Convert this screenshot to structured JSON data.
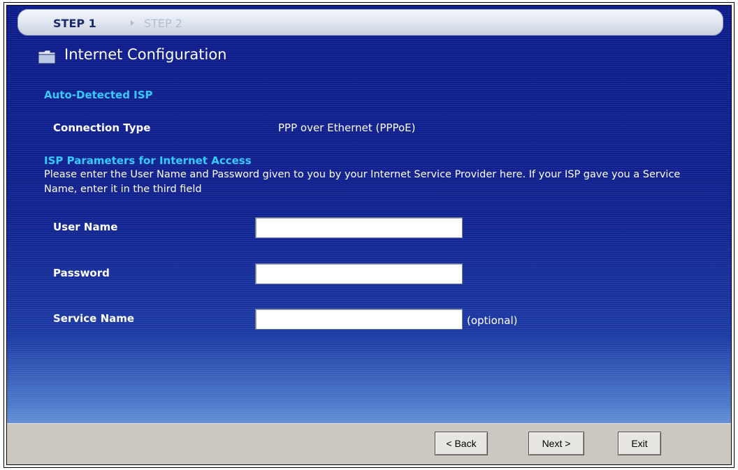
{
  "steps": {
    "current": "STEP 1",
    "next": "STEP 2"
  },
  "page": {
    "title": "Internet Configuration"
  },
  "auto_detect": {
    "heading": "Auto-Detected ISP",
    "connection_type_label": "Connection Type",
    "connection_type_value": "PPP over Ethernet (PPPoE)"
  },
  "isp_params": {
    "heading": "ISP Parameters for Internet Access",
    "description": "Please enter the User Name and Password given to you by your Internet Service Provider here. If your ISP gave you a Service Name, enter it in the third field"
  },
  "form": {
    "user_name_label": "User Name",
    "user_name_value": "",
    "password_label": "Password",
    "password_value": "",
    "service_name_label": "Service Name",
    "service_name_value": "",
    "optional_note": "(optional)"
  },
  "buttons": {
    "back": "< Back",
    "next": "Next >",
    "exit": "Exit"
  }
}
